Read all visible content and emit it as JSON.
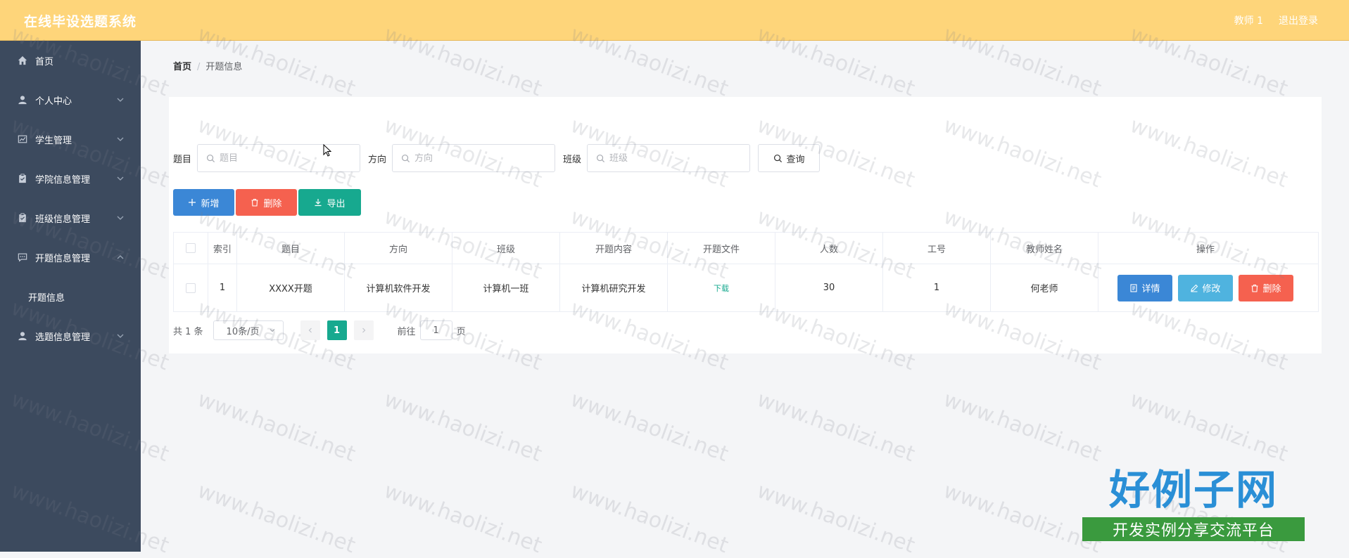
{
  "header": {
    "title": "在线毕设选题系统",
    "user": "教师 1",
    "logout": "退出登录"
  },
  "sidebar": {
    "items": [
      {
        "label": "首页",
        "icon": "home-icon"
      },
      {
        "label": "个人中心",
        "icon": "user-icon"
      },
      {
        "label": "学生管理",
        "icon": "chart-icon"
      },
      {
        "label": "学院信息管理",
        "icon": "clipboard-icon"
      },
      {
        "label": "班级信息管理",
        "icon": "clipboard-icon"
      },
      {
        "label": "开题信息管理",
        "icon": "chat-icon"
      },
      {
        "label": "选题信息管理",
        "icon": "user-icon"
      }
    ],
    "subitem": "开题信息"
  },
  "breadcrumb": {
    "home": "首页",
    "separator": "/",
    "current": "开题信息"
  },
  "search": {
    "title_label": "题目",
    "title_placeholder": "题目",
    "direction_label": "方向",
    "direction_placeholder": "方向",
    "class_label": "班级",
    "class_placeholder": "班级",
    "query": "查询"
  },
  "actions": {
    "add": "新增",
    "delete": "删除",
    "export": "导出"
  },
  "table": {
    "headers": [
      "索引",
      "题目",
      "方向",
      "班级",
      "开题内容",
      "开题文件",
      "人数",
      "工号",
      "教师姓名",
      "操作"
    ],
    "rows": [
      {
        "index": "1",
        "title": "XXXX开题",
        "direction": "计算机软件开发",
        "class": "计算机一班",
        "content": "计算机研究开发",
        "file": "下载",
        "count": "30",
        "job_no": "1",
        "teacher": "何老师"
      }
    ],
    "row_actions": {
      "detail": "详情",
      "edit": "修改",
      "remove": "删除"
    }
  },
  "pagination": {
    "total": "共 1 条",
    "page_size": "10条/页",
    "current": "1",
    "goto": "前往",
    "goto_value": "1",
    "page_unit": "页"
  },
  "watermark": "www.haolizi.net",
  "brand": {
    "name": "好例子网",
    "slogan": "开发实例分享交流平台"
  },
  "colors": {
    "topbar": "#fed57a",
    "sidebar": "#3c4a5e",
    "primary": "#3b87d6",
    "danger": "#f5614f",
    "success": "#17a98f",
    "info": "#4fb3df"
  }
}
